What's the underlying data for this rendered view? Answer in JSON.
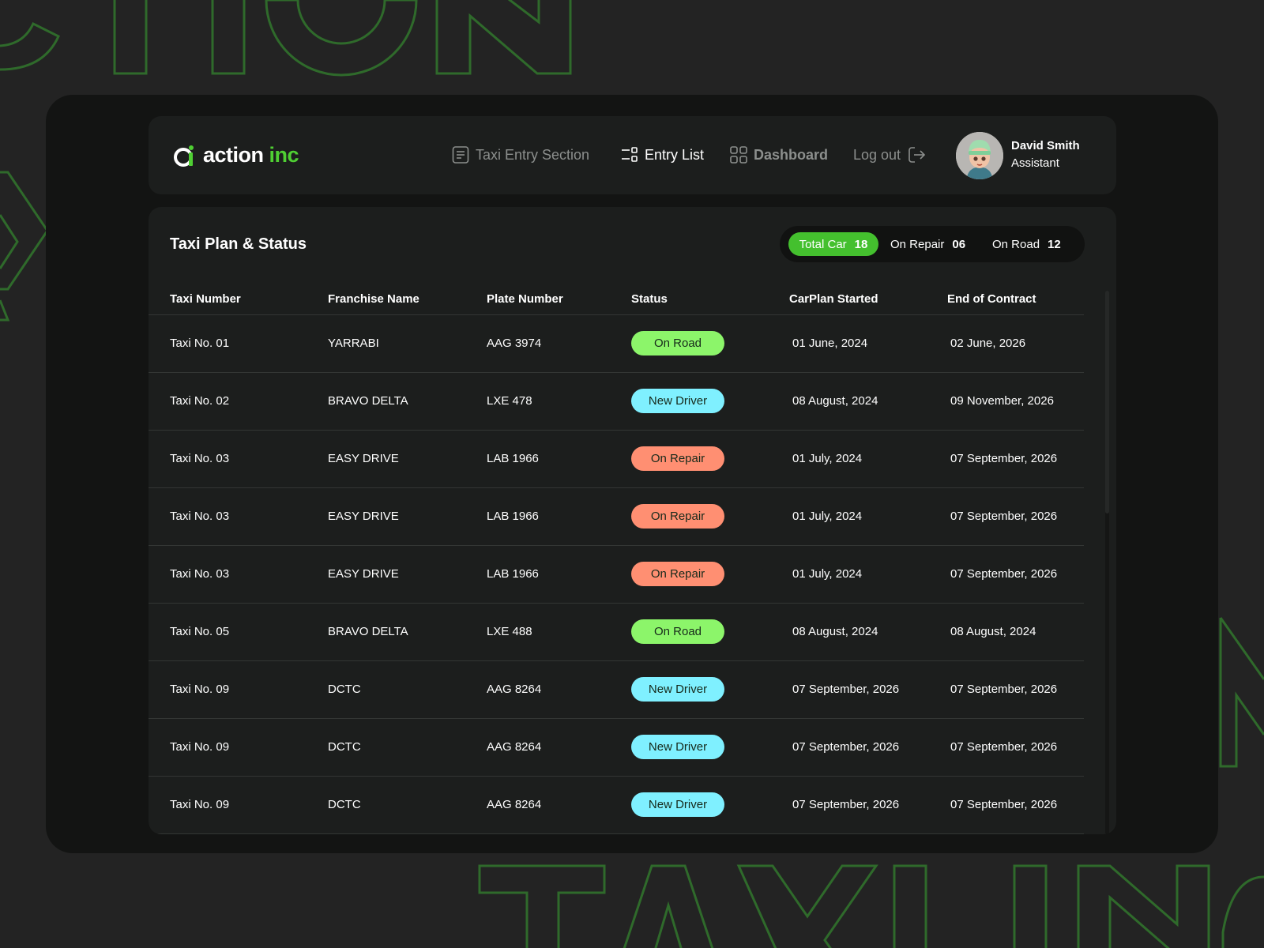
{
  "theme": {
    "accent": "#4fcf33",
    "on_road": "#8cf56a",
    "new_driver": "#7ff0ff",
    "on_repair": "#ff8f72"
  },
  "background": {
    "word_top": "CTION",
    "word_bottom": "TAXI INC"
  },
  "brand": {
    "name_part1": "action",
    "name_part2": " inc"
  },
  "nav": {
    "taxi_entry": "Taxi Entry Section",
    "entry_list": "Entry List",
    "dashboard": "Dashboard",
    "logout": "Log out"
  },
  "user": {
    "name": "David Smith",
    "role": "Assistant"
  },
  "panel": {
    "title": "Taxi Plan & Status",
    "summary": {
      "total_label": "Total Car",
      "total_value": "18",
      "repair_label": "On Repair",
      "repair_value": "06",
      "road_label": "On Road",
      "road_value": "12"
    }
  },
  "table": {
    "headers": [
      "Taxi Number",
      "Franchise Name",
      "Plate Number",
      "Status",
      "CarPlan Started",
      "End of Contract"
    ],
    "rows": [
      {
        "taxi": "Taxi No. 01",
        "franchise": "YARRABI",
        "plate": "AAG 3974",
        "status": "On Road",
        "start": "01 June, 2024",
        "end": "02 June, 2026"
      },
      {
        "taxi": "Taxi No. 02",
        "franchise": "BRAVO DELTA",
        "plate": "LXE 478",
        "status": "New Driver",
        "start": "08 August, 2024",
        "end": "09 November, 2026"
      },
      {
        "taxi": "Taxi No. 03",
        "franchise": "EASY DRIVE",
        "plate": "LAB 1966",
        "status": "On Repair",
        "start": "01 July, 2024",
        "end": "07 September, 2026"
      },
      {
        "taxi": "Taxi No. 03",
        "franchise": "EASY DRIVE",
        "plate": "LAB 1966",
        "status": "On Repair",
        "start": "01 July, 2024",
        "end": "07 September, 2026"
      },
      {
        "taxi": "Taxi No. 03",
        "franchise": "EASY DRIVE",
        "plate": "LAB 1966",
        "status": "On Repair",
        "start": "01 July, 2024",
        "end": "07 September, 2026"
      },
      {
        "taxi": "Taxi No. 05",
        "franchise": "BRAVO DELTA",
        "plate": "LXE 488",
        "status": "On Road",
        "start": "08 August, 2024",
        "end": "08 August, 2024"
      },
      {
        "taxi": "Taxi No. 09",
        "franchise": "DCTC",
        "plate": "AAG 8264",
        "status": "New Driver",
        "start": "07 September, 2026",
        "end": "07 September, 2026"
      },
      {
        "taxi": "Taxi No. 09",
        "franchise": "DCTC",
        "plate": "AAG 8264",
        "status": "New Driver",
        "start": "07 September, 2026",
        "end": "07 September, 2026"
      },
      {
        "taxi": "Taxi No. 09",
        "franchise": "DCTC",
        "plate": "AAG 8264",
        "status": "New Driver",
        "start": "07 September, 2026",
        "end": "07 September, 2026"
      }
    ]
  }
}
